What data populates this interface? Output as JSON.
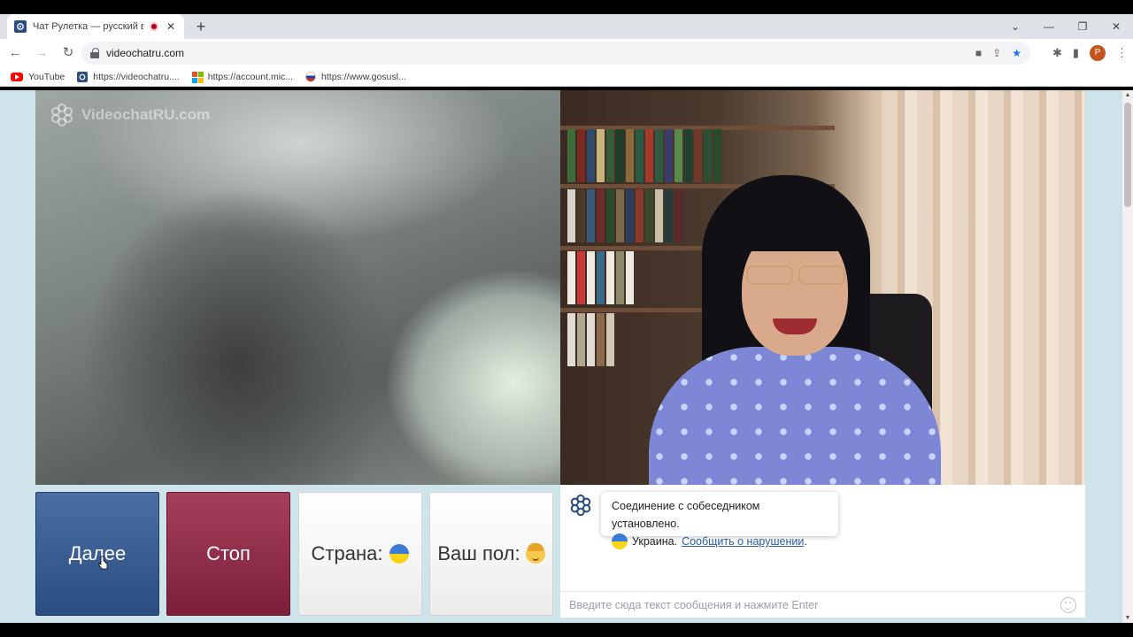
{
  "browser": {
    "tab": {
      "title": "Чат Рулетка — русский вид",
      "close": "✕"
    },
    "new_tab": "+",
    "window_controls": {
      "dropdown": "⌄",
      "minimize": "—",
      "maximize": "❐",
      "close": "✕"
    },
    "nav": {
      "back": "←",
      "forward": "→",
      "reload": "↻"
    },
    "url": "videochatru.com",
    "omni_icons": {
      "camera": "■",
      "share": "⇪",
      "star": "★"
    },
    "toolbar": {
      "extensions": "✱",
      "sidebar": "▮",
      "profile_initial": "P",
      "menu": "⋮"
    },
    "bookmarks": [
      {
        "label": "YouTube",
        "icon": "youtube-icon"
      },
      {
        "label": "https://videochatru....",
        "icon": "videochat-icon"
      },
      {
        "label": "https://account.mic...",
        "icon": "microsoft-icon"
      },
      {
        "label": "https://www.gosusl...",
        "icon": "russia-flag-icon"
      }
    ],
    "scrollbar": {
      "up": "▲",
      "down": "▼"
    }
  },
  "video": {
    "logo_text": "VideochatRU.com"
  },
  "controls": {
    "next_label": "Далее",
    "stop_label": "Стоп",
    "country_label": "Страна:",
    "gender_label": "Ваш пол:"
  },
  "chat": {
    "system_message": "Соединение с собеседником установлено.",
    "country_name": "Украина.",
    "report_link": "Сообщить о нарушении",
    "report_suffix": ".",
    "input_placeholder": "Введите сюда текст сообщения и нажмите Enter"
  },
  "colors": {
    "next_button": "#2b4e82",
    "stop_button": "#7c1f3b",
    "page_background": "#cfe3ea",
    "link": "#2a5fa0"
  }
}
